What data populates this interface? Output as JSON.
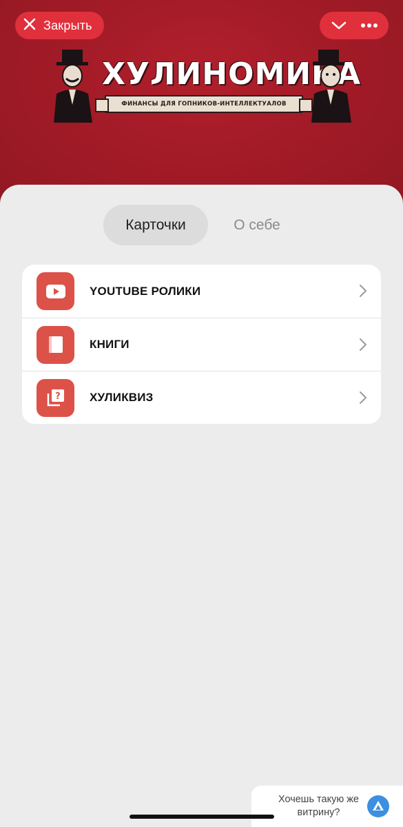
{
  "header": {
    "close_label": "Закрыть",
    "logo_title": "ХУЛИНОМИКА",
    "logo_subtitle": "ФИНАНСЫ ДЛЯ ГОПНИКОВ-ИНТЕЛЛЕКТУАЛОВ",
    "icons": [
      "close-icon",
      "chevron-down-icon",
      "more-dots-icon"
    ]
  },
  "tabs": [
    {
      "label": "Карточки",
      "active": true
    },
    {
      "label": "О себе",
      "active": false
    }
  ],
  "cards": [
    {
      "label": "YOUTUBE РОЛИКИ",
      "icon": "youtube-icon"
    },
    {
      "label": "КНИГИ",
      "icon": "book-icon"
    },
    {
      "label": "ХУЛИКВИЗ",
      "icon": "quiz-icon"
    }
  ],
  "cta": {
    "text_line1": "Хочешь такую же",
    "text_line2": "витрину?"
  },
  "colors": {
    "brand_red": "#9a1c26",
    "button_red": "#e0303c",
    "icon_tile": "#dc5248",
    "sheet_bg": "#ececec",
    "cta_blue": "#3d8fe0"
  }
}
